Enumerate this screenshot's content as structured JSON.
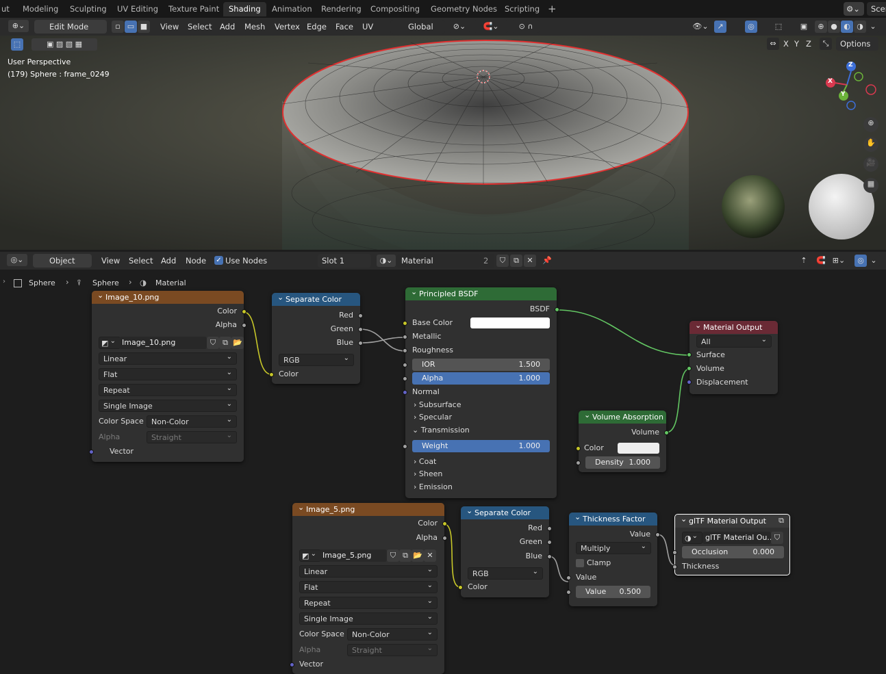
{
  "workspaces": [
    "ut",
    "Modeling",
    "Sculpting",
    "UV Editing",
    "Texture Paint",
    "Shading",
    "Animation",
    "Rendering",
    "Compositing",
    "Geometry Nodes",
    "Scripting"
  ],
  "scene_label": "Scen",
  "viewport_header": {
    "mode": "Edit Mode",
    "menus": [
      "View",
      "Select",
      "Add",
      "Mesh",
      "Vertex",
      "Edge",
      "Face",
      "UV"
    ],
    "orientation": "Global",
    "options": "Options",
    "axes": [
      "X",
      "Y",
      "Z"
    ]
  },
  "viewport": {
    "title": "User Perspective",
    "subtitle": "(179) Sphere : frame_0249",
    "gizmo": {
      "z": "Z",
      "x": "X",
      "y": "Y"
    }
  },
  "node_header": {
    "type": "Object",
    "menus": [
      "View",
      "Select",
      "Add",
      "Node"
    ],
    "use_nodes": "Use Nodes",
    "slot": "Slot 1",
    "material": "Material",
    "users": "2"
  },
  "breadcrumb": [
    "Sphere",
    "Sphere",
    "Material"
  ],
  "nodes": {
    "image10": {
      "title": "Image_10.png",
      "out_color": "Color",
      "out_alpha": "Alpha",
      "file": "Image_10.png",
      "interp": "Linear",
      "proj": "Flat",
      "ext": "Repeat",
      "source": "Single Image",
      "cs_label": "Color Space",
      "cs_value": "Non-Color",
      "alpha_label": "Alpha",
      "alpha_value": "Straight",
      "in_vector": "Vector"
    },
    "sep1": {
      "title": "Separate Color",
      "red": "Red",
      "green": "Green",
      "blue": "Blue",
      "mode": "RGB",
      "in_color": "Color"
    },
    "bsdf": {
      "title": "Principled BSDF",
      "out": "BSDF",
      "base_color": "Base Color",
      "metallic": "Metallic",
      "roughness": "Roughness",
      "ior_label": "IOR",
      "ior": "1.500",
      "alpha_label": "Alpha",
      "alpha": "1.000",
      "normal": "Normal",
      "subsurface": "Subsurface",
      "specular": "Specular",
      "transmission": "Transmission",
      "weight_label": "Weight",
      "weight": "1.000",
      "coat": "Coat",
      "sheen": "Sheen",
      "emission": "Emission"
    },
    "matout": {
      "title": "Material Output",
      "target": "All",
      "surface": "Surface",
      "volume": "Volume",
      "displacement": "Displacement"
    },
    "volabs": {
      "title": "Volume Absorption",
      "out": "Volume",
      "color": "Color",
      "density_label": "Density",
      "density": "1.000"
    },
    "image5": {
      "title": "Image_5.png",
      "out_color": "Color",
      "out_alpha": "Alpha",
      "file": "Image_5.png",
      "interp": "Linear",
      "proj": "Flat",
      "ext": "Repeat",
      "source": "Single Image",
      "cs_label": "Color Space",
      "cs_value": "Non-Color",
      "alpha_label": "Alpha",
      "alpha_value": "Straight",
      "in_vector": "Vector"
    },
    "sep2": {
      "title": "Separate Color",
      "red": "Red",
      "green": "Green",
      "blue": "Blue",
      "mode": "RGB",
      "in_color": "Color"
    },
    "thick": {
      "title": "Thickness Factor",
      "out": "Value",
      "op": "Multiply",
      "clamp": "Clamp",
      "in_value": "Value",
      "value_label": "Value",
      "value": "0.500"
    },
    "gltf": {
      "title": "glTF Material Output",
      "group": "glTF Material Ou...",
      "occ_label": "Occlusion",
      "occ": "0.000",
      "thickness": "Thickness"
    }
  },
  "colors": {
    "accent": "#4772b3",
    "image_header": "#7a4a22",
    "converter_header": "#27567f",
    "shader_header": "#2e6b36",
    "output_header": "#6a2a35",
    "link_color": "#c7c729",
    "link_shader": "#63c763",
    "selection": "#e03030"
  }
}
